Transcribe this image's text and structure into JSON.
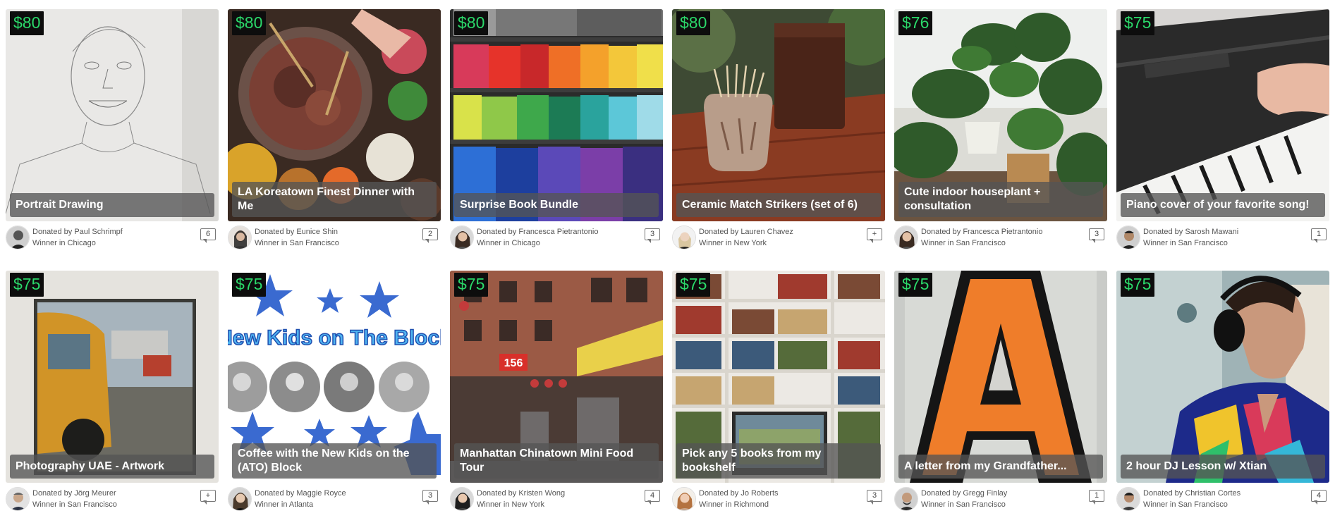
{
  "cards": [
    {
      "price": "$80",
      "title": "Portrait Drawing",
      "donor": "Donated by Paul Schrimpf",
      "winner": "Winner in Chicago",
      "comments": "6"
    },
    {
      "price": "$80",
      "title": "LA Koreatown Finest Dinner with Me",
      "donor": "Donated by Eunice Shin",
      "winner": "Winner in San Francisco",
      "comments": "2"
    },
    {
      "price": "$80",
      "title": "Surprise Book Bundle",
      "donor": "Donated by Francesca Pietrantonio",
      "winner": "Winner in Chicago",
      "comments": "3"
    },
    {
      "price": "$80",
      "title": "Ceramic Match Strikers (set of 6)",
      "donor": "Donated by Lauren Chavez",
      "winner": "Winner in New York",
      "comments": "+"
    },
    {
      "price": "$76",
      "title": "Cute indoor houseplant + consultation",
      "donor": "Donated by Francesca Pietrantonio",
      "winner": "Winner in San Francisco",
      "comments": "3"
    },
    {
      "price": "$75",
      "title": "Piano cover of your favorite song!",
      "donor": "Donated by Sarosh Mawani",
      "winner": "Winner in San Francisco",
      "comments": "1"
    },
    {
      "price": "$75",
      "title": "Photography UAE - Artwork",
      "donor": "Donated by Jörg Meurer",
      "winner": "Winner in San Francisco",
      "comments": "+"
    },
    {
      "price": "$75",
      "title": "Coffee with the New Kids on the (ATO) Block",
      "donor": "Donated by Maggie Royce",
      "winner": "Winner in Atlanta",
      "comments": "3",
      "image_text": "New Kids on The Block"
    },
    {
      "price": "$75",
      "title": "Manhattan Chinatown Mini Food Tour",
      "donor": "Donated by Kristen Wong",
      "winner": "Winner in New York",
      "comments": "4",
      "image_text": "156"
    },
    {
      "price": "$75",
      "title": "Pick any 5 books from my bookshelf",
      "donor": "Donated by Jo Roberts",
      "winner": "Winner in Richmond",
      "comments": "3"
    },
    {
      "price": "$75",
      "title": "A letter from my Grandfather...",
      "donor": "Donated by Gregg Finlay",
      "winner": "Winner in San Francisco",
      "comments": "1"
    },
    {
      "price": "$75",
      "title": "2 hour DJ Lesson w/ Xtian",
      "donor": "Donated by Christian Cortes",
      "winner": "Winner in San Francisco",
      "comments": "4"
    }
  ],
  "colors": {
    "price_bg": "#0d0d0d",
    "price_text": "#2bd96a",
    "title_bar": "#555555"
  },
  "icons": {
    "comment": "comment-bubble-icon"
  }
}
